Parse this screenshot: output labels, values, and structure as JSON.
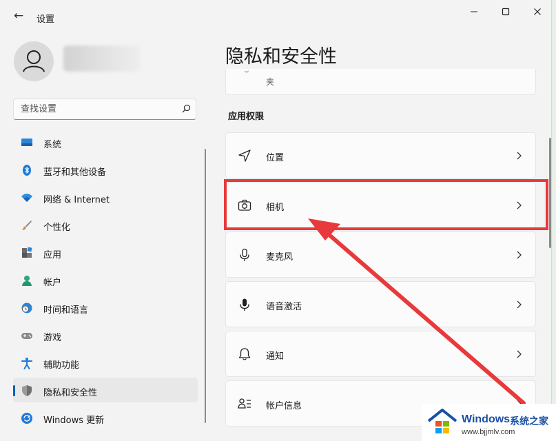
{
  "window": {
    "title": "设置"
  },
  "profile": {
    "name": ""
  },
  "search": {
    "placeholder": "查找设置"
  },
  "sidebar": {
    "items": [
      {
        "label": "系统",
        "icon": "monitor-icon"
      },
      {
        "label": "蓝牙和其他设备",
        "icon": "bluetooth-icon"
      },
      {
        "label": "网络 & Internet",
        "icon": "wifi-icon"
      },
      {
        "label": "个性化",
        "icon": "brush-icon"
      },
      {
        "label": "应用",
        "icon": "apps-icon"
      },
      {
        "label": "帐户",
        "icon": "account-icon"
      },
      {
        "label": "时间和语言",
        "icon": "clock-globe-icon"
      },
      {
        "label": "游戏",
        "icon": "gamepad-icon"
      },
      {
        "label": "辅助功能",
        "icon": "accessibility-icon"
      },
      {
        "label": "隐私和安全性",
        "icon": "shield-icon",
        "selected": true
      },
      {
        "label": "Windows 更新",
        "icon": "update-icon"
      }
    ]
  },
  "page": {
    "title": "隐私和安全性",
    "top_card_subtitle": "夹",
    "section_title": "应用权限",
    "permissions": [
      {
        "label": "位置",
        "icon": "location-arrow-icon"
      },
      {
        "label": "相机",
        "icon": "camera-icon"
      },
      {
        "label": "麦克风",
        "icon": "microphone-icon"
      },
      {
        "label": "语音激活",
        "icon": "microphone-voice-icon"
      },
      {
        "label": "通知",
        "icon": "bell-icon"
      },
      {
        "label": "帐户信息",
        "icon": "account-info-icon"
      }
    ]
  },
  "watermark": {
    "title": "Windows",
    "subtitle": "系统之家",
    "url": "www.bjjmlv.com"
  },
  "colors": {
    "accent": "#005fb8",
    "annotation": "#e8393b",
    "watermark": "#1a4fa6"
  }
}
